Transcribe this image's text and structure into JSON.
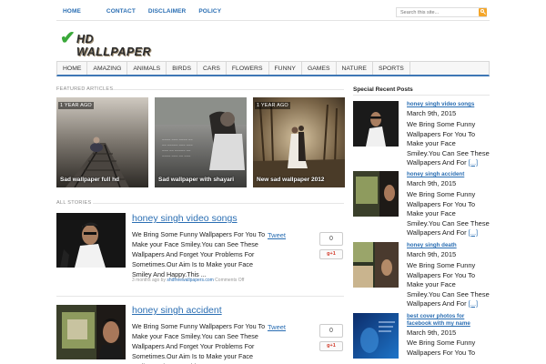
{
  "top_nav": {
    "items": [
      "HOME",
      "CONTACT",
      "DISCLAIMER",
      "POLICY"
    ],
    "search_placeholder": "Search this site..."
  },
  "logo": {
    "text": "HD WALLPAPER"
  },
  "main_nav": {
    "items": [
      "HOME",
      "AMAZING",
      "ANIMALS",
      "BIRDS",
      "CARS",
      "FLOWERS",
      "FUNNY",
      "GAMES",
      "NATURE",
      "SPORTS"
    ]
  },
  "featured": {
    "label": "FEATURED ARTICLES",
    "items": [
      {
        "badge": "1 YEAR AGO",
        "caption": "Sad wallpaper full hd"
      },
      {
        "badge": "1 YEAR AGO",
        "caption": "Sad wallpaper with shayari"
      },
      {
        "badge": "1 YEAR AGO",
        "caption": "New sad wallpaper 2012"
      }
    ]
  },
  "stories": {
    "label": "ALL STORIES",
    "items": [
      {
        "title": "honey singh video songs",
        "excerpt": "We Bring Some Funny Wallpapers For You To Make your Face Smiley.You can See These Wallpapers And Forget Your Problems For Sometimes.Our Aim Is to Make your Face Smiley And Happy.This ...",
        "tweet": "Tweet",
        "count": "0",
        "gplus": "g+1",
        "meta_prefix": "3 months ago by",
        "meta_author": "shdfreewallpapers.com",
        "meta_comments": "Comments Off"
      },
      {
        "title": "honey singh accident",
        "excerpt": "We Bring Some Funny Wallpapers For You To Make your Face Smiley.You can See These Wallpapers And Forget Your Problems For Sometimes.Our Aim Is to Make your Face Smiley And Happy.This ...",
        "tweet": "Tweet",
        "count": "0",
        "gplus": "g+1"
      }
    ]
  },
  "sidebar": {
    "title": "Special Recent Posts",
    "posts": [
      {
        "title": "honey singh video songs",
        "date": "March 9th, 2015",
        "text": "We Bring Some Funny Wallpapers For You To Make your Face Smiley.You Can See These Wallpapers And For",
        "more": "[...]"
      },
      {
        "title": "honey singh accident",
        "date": "March 9th, 2015",
        "text": "We Bring Some Funny Wallpapers For You To Make your Face Smiley.You Can See These Wallpapers And For",
        "more": "[...]"
      },
      {
        "title": "honey singh death",
        "date": "March 9th, 2015",
        "text": "We Bring Some Funny Wallpapers For You To Make your Face Smiley.You Can See These Wallpapers And For",
        "more": "[...]"
      },
      {
        "title": "best cover photos for facebook with my name",
        "date": "March 9th, 2015",
        "text": "We Bring Some Funny Wallpapers For You To",
        "more": ""
      }
    ]
  },
  "colors": {
    "link": "#2a6eb3",
    "nav_accent": "#3e77b5",
    "search_button": "#f4a62a",
    "logo_check": "#3aa83a"
  }
}
